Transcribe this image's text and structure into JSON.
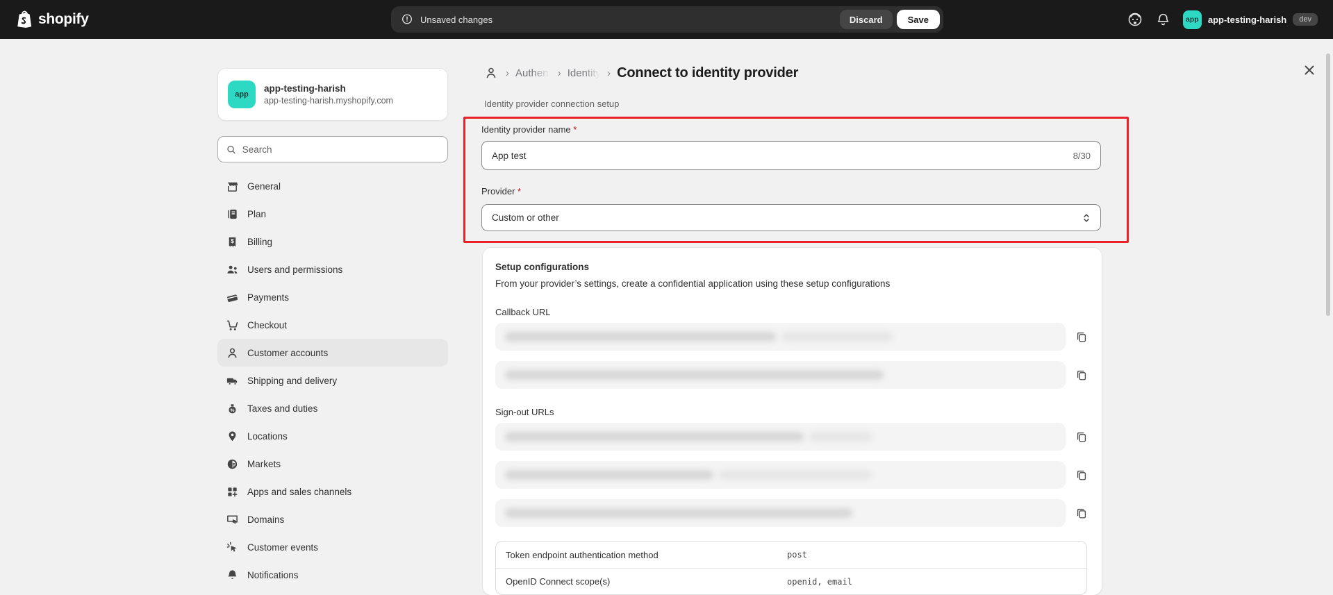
{
  "topbar": {
    "logo_text": "shopify",
    "status_text": "Unsaved changes",
    "discard_label": "Discard",
    "save_label": "Save",
    "store_avatar_text": "app",
    "store_name": "app-testing-harish",
    "env_badge": "dev"
  },
  "sidebar": {
    "store_name": "app-testing-harish",
    "store_domain": "app-testing-harish.myshopify.com",
    "avatar_text": "app",
    "search_placeholder": "Search",
    "items": [
      {
        "label": "General",
        "selected": false
      },
      {
        "label": "Plan",
        "selected": false
      },
      {
        "label": "Billing",
        "selected": false
      },
      {
        "label": "Users and permissions",
        "selected": false
      },
      {
        "label": "Payments",
        "selected": false
      },
      {
        "label": "Checkout",
        "selected": false
      },
      {
        "label": "Customer accounts",
        "selected": true
      },
      {
        "label": "Shipping and delivery",
        "selected": false
      },
      {
        "label": "Taxes and duties",
        "selected": false
      },
      {
        "label": "Locations",
        "selected": false
      },
      {
        "label": "Markets",
        "selected": false
      },
      {
        "label": "Apps and sales channels",
        "selected": false
      },
      {
        "label": "Domains",
        "selected": false
      },
      {
        "label": "Customer events",
        "selected": false
      },
      {
        "label": "Notifications",
        "selected": false
      }
    ]
  },
  "breadcrumb": {
    "separator": "›",
    "crumb1": "Authent",
    "crumb2": "Identity",
    "current": "Connect to identity provider",
    "subtitle": "Identity provider connection setup"
  },
  "form": {
    "name_label": "Identity provider name",
    "required_mark": "*",
    "name_value": "App test",
    "name_counter": "8/30",
    "provider_label": "Provider",
    "provider_value": "Custom or other"
  },
  "setup": {
    "heading": "Setup configurations",
    "description": "From your provider’s settings, create a confidential application using these setup configurations",
    "callback_label": "Callback URL",
    "signout_label": "Sign-out URLs",
    "config_rows": [
      {
        "label": "Token endpoint authentication method",
        "value": "post"
      },
      {
        "label": "OpenID Connect scope(s)",
        "value": "openid, email"
      }
    ]
  },
  "colors": {
    "topbar_bg": "#1a1a1a",
    "page_bg": "#f1f1f1",
    "accent_teal": "#2ed9c3",
    "annotation_red": "#ea2127",
    "required_red": "#b31412"
  }
}
